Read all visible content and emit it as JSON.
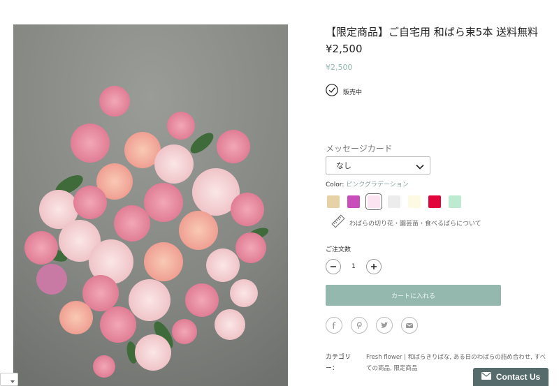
{
  "product": {
    "title": "【限定商品】ご自宅用 和ばら束5本 送料無料",
    "price": "¥2,500",
    "price_sub": "¥2,500",
    "stock_status": "販売中",
    "image_icon": "rose-bouquet-photo"
  },
  "message_card": {
    "label": "メッセージカード",
    "selected": "なし"
  },
  "color": {
    "label": "Color:",
    "selected": "ピンクグラデーション",
    "swatches": [
      "#e6d2a6",
      "#c84fb9",
      "#fde4f1",
      "#ececec",
      "#fdfae3",
      "#e2053b",
      "#bdebd2"
    ],
    "selected_index": 2
  },
  "about_link": "わばらの切り花・園芸苗・食べるばらについて",
  "quantity": {
    "label": "ご注文数",
    "value": "1"
  },
  "cart_button": "カートに入れる",
  "share_icons": [
    "facebook-icon",
    "pinterest-icon",
    "twitter-icon",
    "email-icon"
  ],
  "category": {
    "label": "カテゴリー：",
    "value": "Fresh flower | 和ばらきりばな, ある日のわばらの詰め合わせ, すべての商品, 限定商品"
  },
  "contact_button": "Contact Us",
  "accent_color": "#94b8ae"
}
